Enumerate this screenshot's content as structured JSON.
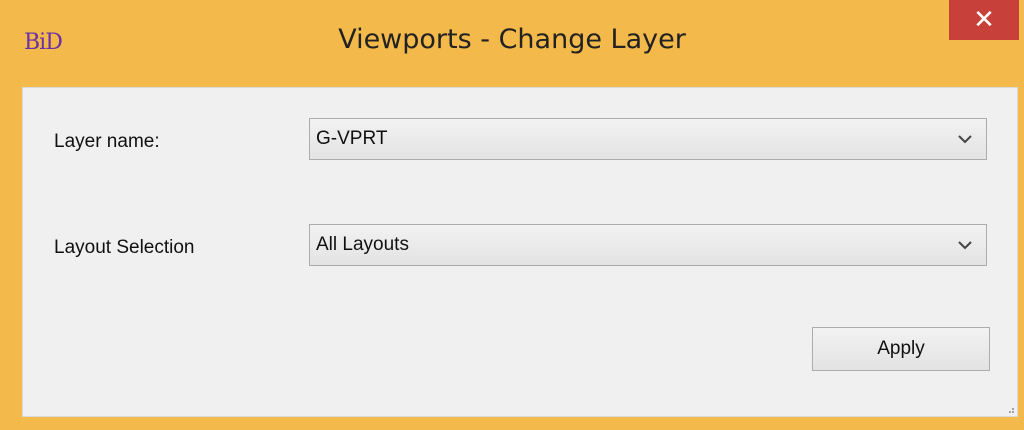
{
  "window": {
    "app_logo": "BiD",
    "title": "Viewports - Change Layer",
    "close_label": "✕"
  },
  "form": {
    "layer_name_label": "Layer name:",
    "layer_name_value": "G-VPRT",
    "layout_selection_label": "Layout Selection",
    "layout_selection_value": "All Layouts",
    "apply_label": "Apply"
  },
  "icons": {
    "dropdown_arrow": "chevron-down-icon",
    "close": "close-icon",
    "resize": "resize-grip-icon"
  },
  "colors": {
    "titlebar": "#f3b94a",
    "close_button": "#c7403a",
    "client_area": "#f0f0f0",
    "logo": "#6b2fa8"
  }
}
